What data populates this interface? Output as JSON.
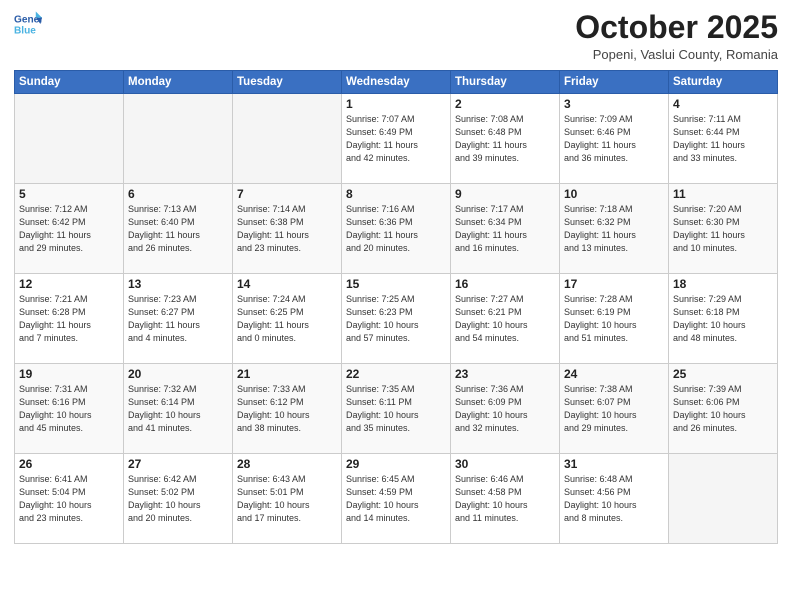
{
  "header": {
    "logo_line1": "General",
    "logo_line2": "Blue",
    "month": "October 2025",
    "location": "Popeni, Vaslui County, Romania"
  },
  "days_of_week": [
    "Sunday",
    "Monday",
    "Tuesday",
    "Wednesday",
    "Thursday",
    "Friday",
    "Saturday"
  ],
  "weeks": [
    [
      {
        "day": "",
        "info": ""
      },
      {
        "day": "",
        "info": ""
      },
      {
        "day": "",
        "info": ""
      },
      {
        "day": "1",
        "info": "Sunrise: 7:07 AM\nSunset: 6:49 PM\nDaylight: 11 hours\nand 42 minutes."
      },
      {
        "day": "2",
        "info": "Sunrise: 7:08 AM\nSunset: 6:48 PM\nDaylight: 11 hours\nand 39 minutes."
      },
      {
        "day": "3",
        "info": "Sunrise: 7:09 AM\nSunset: 6:46 PM\nDaylight: 11 hours\nand 36 minutes."
      },
      {
        "day": "4",
        "info": "Sunrise: 7:11 AM\nSunset: 6:44 PM\nDaylight: 11 hours\nand 33 minutes."
      }
    ],
    [
      {
        "day": "5",
        "info": "Sunrise: 7:12 AM\nSunset: 6:42 PM\nDaylight: 11 hours\nand 29 minutes."
      },
      {
        "day": "6",
        "info": "Sunrise: 7:13 AM\nSunset: 6:40 PM\nDaylight: 11 hours\nand 26 minutes."
      },
      {
        "day": "7",
        "info": "Sunrise: 7:14 AM\nSunset: 6:38 PM\nDaylight: 11 hours\nand 23 minutes."
      },
      {
        "day": "8",
        "info": "Sunrise: 7:16 AM\nSunset: 6:36 PM\nDaylight: 11 hours\nand 20 minutes."
      },
      {
        "day": "9",
        "info": "Sunrise: 7:17 AM\nSunset: 6:34 PM\nDaylight: 11 hours\nand 16 minutes."
      },
      {
        "day": "10",
        "info": "Sunrise: 7:18 AM\nSunset: 6:32 PM\nDaylight: 11 hours\nand 13 minutes."
      },
      {
        "day": "11",
        "info": "Sunrise: 7:20 AM\nSunset: 6:30 PM\nDaylight: 11 hours\nand 10 minutes."
      }
    ],
    [
      {
        "day": "12",
        "info": "Sunrise: 7:21 AM\nSunset: 6:28 PM\nDaylight: 11 hours\nand 7 minutes."
      },
      {
        "day": "13",
        "info": "Sunrise: 7:23 AM\nSunset: 6:27 PM\nDaylight: 11 hours\nand 4 minutes."
      },
      {
        "day": "14",
        "info": "Sunrise: 7:24 AM\nSunset: 6:25 PM\nDaylight: 11 hours\nand 0 minutes."
      },
      {
        "day": "15",
        "info": "Sunrise: 7:25 AM\nSunset: 6:23 PM\nDaylight: 10 hours\nand 57 minutes."
      },
      {
        "day": "16",
        "info": "Sunrise: 7:27 AM\nSunset: 6:21 PM\nDaylight: 10 hours\nand 54 minutes."
      },
      {
        "day": "17",
        "info": "Sunrise: 7:28 AM\nSunset: 6:19 PM\nDaylight: 10 hours\nand 51 minutes."
      },
      {
        "day": "18",
        "info": "Sunrise: 7:29 AM\nSunset: 6:18 PM\nDaylight: 10 hours\nand 48 minutes."
      }
    ],
    [
      {
        "day": "19",
        "info": "Sunrise: 7:31 AM\nSunset: 6:16 PM\nDaylight: 10 hours\nand 45 minutes."
      },
      {
        "day": "20",
        "info": "Sunrise: 7:32 AM\nSunset: 6:14 PM\nDaylight: 10 hours\nand 41 minutes."
      },
      {
        "day": "21",
        "info": "Sunrise: 7:33 AM\nSunset: 6:12 PM\nDaylight: 10 hours\nand 38 minutes."
      },
      {
        "day": "22",
        "info": "Sunrise: 7:35 AM\nSunset: 6:11 PM\nDaylight: 10 hours\nand 35 minutes."
      },
      {
        "day": "23",
        "info": "Sunrise: 7:36 AM\nSunset: 6:09 PM\nDaylight: 10 hours\nand 32 minutes."
      },
      {
        "day": "24",
        "info": "Sunrise: 7:38 AM\nSunset: 6:07 PM\nDaylight: 10 hours\nand 29 minutes."
      },
      {
        "day": "25",
        "info": "Sunrise: 7:39 AM\nSunset: 6:06 PM\nDaylight: 10 hours\nand 26 minutes."
      }
    ],
    [
      {
        "day": "26",
        "info": "Sunrise: 6:41 AM\nSunset: 5:04 PM\nDaylight: 10 hours\nand 23 minutes."
      },
      {
        "day": "27",
        "info": "Sunrise: 6:42 AM\nSunset: 5:02 PM\nDaylight: 10 hours\nand 20 minutes."
      },
      {
        "day": "28",
        "info": "Sunrise: 6:43 AM\nSunset: 5:01 PM\nDaylight: 10 hours\nand 17 minutes."
      },
      {
        "day": "29",
        "info": "Sunrise: 6:45 AM\nSunset: 4:59 PM\nDaylight: 10 hours\nand 14 minutes."
      },
      {
        "day": "30",
        "info": "Sunrise: 6:46 AM\nSunset: 4:58 PM\nDaylight: 10 hours\nand 11 minutes."
      },
      {
        "day": "31",
        "info": "Sunrise: 6:48 AM\nSunset: 4:56 PM\nDaylight: 10 hours\nand 8 minutes."
      },
      {
        "day": "",
        "info": ""
      }
    ]
  ]
}
